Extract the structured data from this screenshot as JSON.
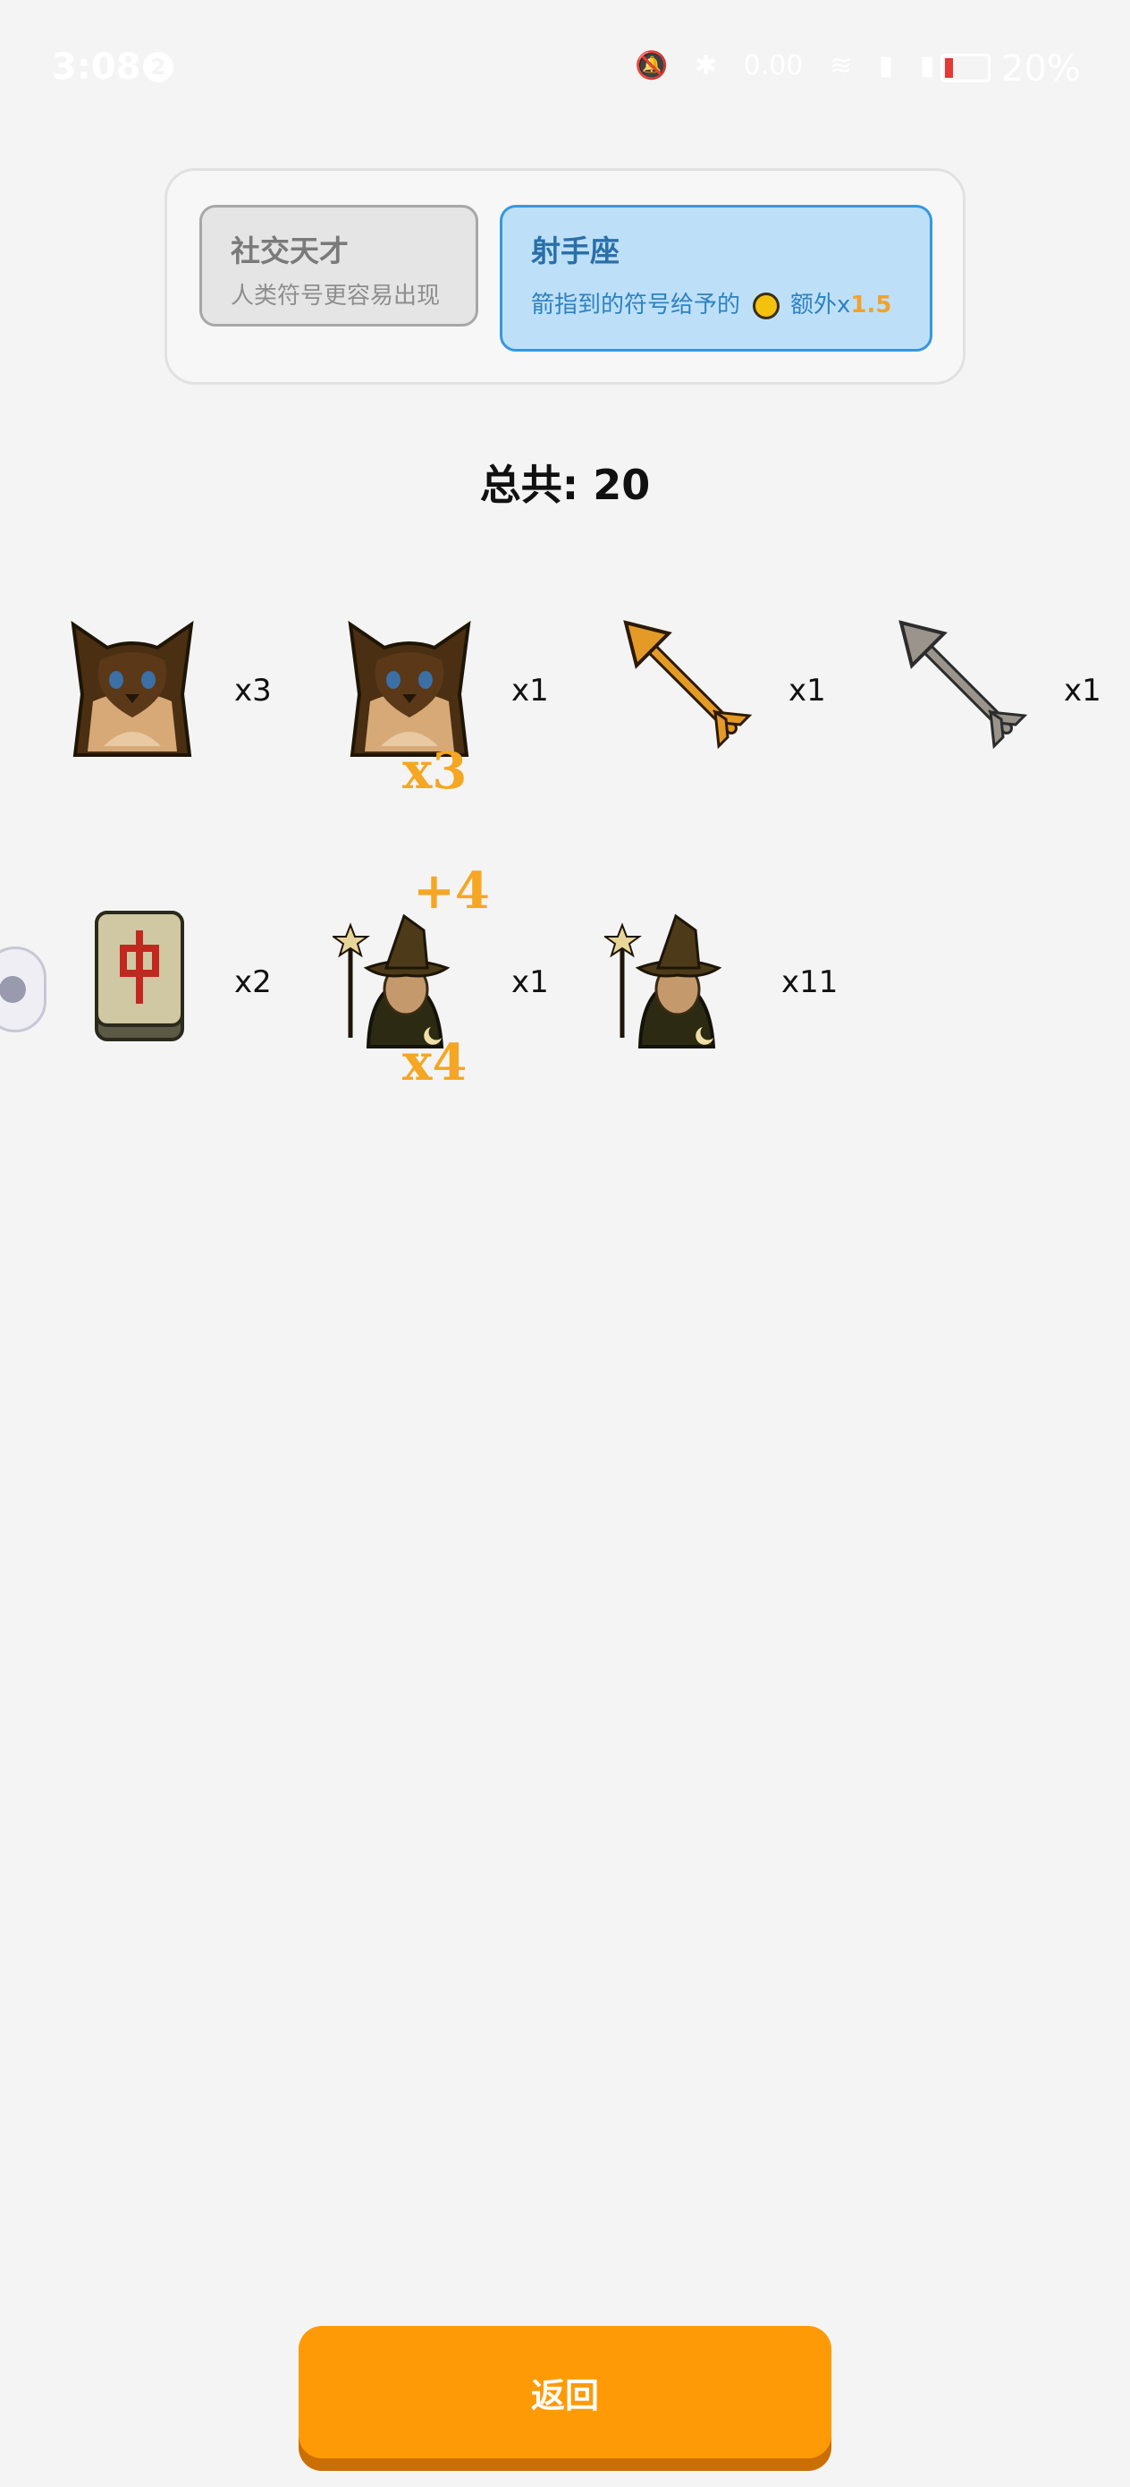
{
  "status_bar": {
    "time": "3:08",
    "notification_count": "2",
    "network_speed": "0.00",
    "battery_percent": "20%",
    "battery_level": 0.2
  },
  "traits": [
    {
      "title": "社交天才",
      "desc": "人类符号更容易出现",
      "selected": false
    },
    {
      "title": "射手座",
      "desc_prefix": "箭指到的符号给予的",
      "desc_suffix": "额外x",
      "multiplier": "1.5",
      "selected": true
    }
  ],
  "total_label": "总共: 20",
  "symbols": [
    {
      "icon": "cat-icon",
      "count": "x3"
    },
    {
      "icon": "cat-icon",
      "count": "x1",
      "overlay_bottom": "x3"
    },
    {
      "icon": "golden-arrow-icon",
      "count": "x1"
    },
    {
      "icon": "gray-arrow-icon",
      "count": "x1"
    },
    {
      "icon": "mahjong-tile-icon",
      "count": "x2"
    },
    {
      "icon": "witch-icon",
      "count": "x1",
      "overlay_top": "+4",
      "overlay_bottom": "x4"
    },
    {
      "icon": "witch-icon",
      "count": "x11"
    }
  ],
  "back_button": "返回",
  "colors": {
    "accent": "#fe9a05",
    "selected_card": "#bde0f8",
    "selected_border": "#3598e0",
    "multiplier": "#f4a12a"
  }
}
